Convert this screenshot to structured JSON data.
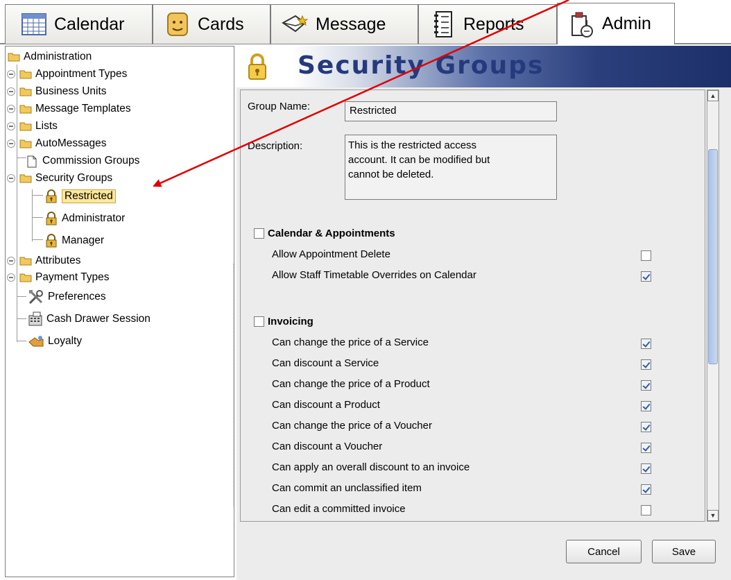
{
  "tabs": [
    {
      "label": "Calendar",
      "icon": "calendar-icon"
    },
    {
      "label": "Cards",
      "icon": "face-card-icon"
    },
    {
      "label": "Message",
      "icon": "message-star-icon"
    },
    {
      "label": "Reports",
      "icon": "notebook-icon"
    },
    {
      "label": "Admin",
      "icon": "admin-clipboard-icon",
      "active": true
    }
  ],
  "tree": {
    "root": "Administration",
    "items": [
      {
        "label": "Appointment Types",
        "icon": "folder-icon"
      },
      {
        "label": "Business Units",
        "icon": "folder-icon"
      },
      {
        "label": "Message Templates",
        "icon": "folder-icon"
      },
      {
        "label": "Lists",
        "icon": "folder-icon"
      },
      {
        "label": "AutoMessages",
        "icon": "folder-icon"
      },
      {
        "label": "Commission Groups",
        "icon": "document-icon"
      },
      {
        "label": "Security Groups",
        "icon": "folder-icon"
      },
      {
        "label": "Restricted",
        "icon": "lock-icon",
        "selected": true
      },
      {
        "label": "Administrator",
        "icon": "lock-icon"
      },
      {
        "label": "Manager",
        "icon": "lock-icon"
      },
      {
        "label": "Attributes",
        "icon": "folder-icon"
      },
      {
        "label": "Payment Types",
        "icon": "folder-icon"
      },
      {
        "label": "Preferences",
        "icon": "tools-icon"
      },
      {
        "label": "Cash Drawer Session",
        "icon": "cash-register-icon"
      },
      {
        "label": "Loyalty",
        "icon": "loyalty-icon"
      }
    ]
  },
  "panel": {
    "title": "Security Groups",
    "group_name_label": "Group Name:",
    "group_name_value": "Restricted",
    "description_label": "Description:",
    "description_value": "This is the restricted access\naccount. It can be modified but\ncannot be deleted.",
    "sections": [
      {
        "title": "Calendar & Appointments",
        "checked": false,
        "permissions": [
          {
            "label": "Allow Appointment Delete",
            "checked": false
          },
          {
            "label": "Allow Staff Timetable Overrides on Calendar",
            "checked": true
          }
        ]
      },
      {
        "title": "Invoicing",
        "checked": false,
        "permissions": [
          {
            "label": "Can change the price of a Service",
            "checked": true
          },
          {
            "label": "Can discount a Service",
            "checked": true
          },
          {
            "label": "Can change the price of a Product",
            "checked": true
          },
          {
            "label": "Can discount a Product",
            "checked": true
          },
          {
            "label": "Can change the price of a Voucher",
            "checked": true
          },
          {
            "label": "Can discount a Voucher",
            "checked": true
          },
          {
            "label": "Can apply an overall discount to an invoice",
            "checked": true
          },
          {
            "label": "Can commit an unclassified item",
            "checked": true
          },
          {
            "label": "Can edit a committed invoice",
            "checked": false
          }
        ]
      }
    ],
    "buttons": {
      "cancel": "Cancel",
      "save": "Save"
    }
  },
  "colors": {
    "header_dark": "#1d2f6a",
    "title_text": "#253a7d",
    "selection_bg": "#fce79b",
    "annotation_arrow": "#e00000"
  }
}
